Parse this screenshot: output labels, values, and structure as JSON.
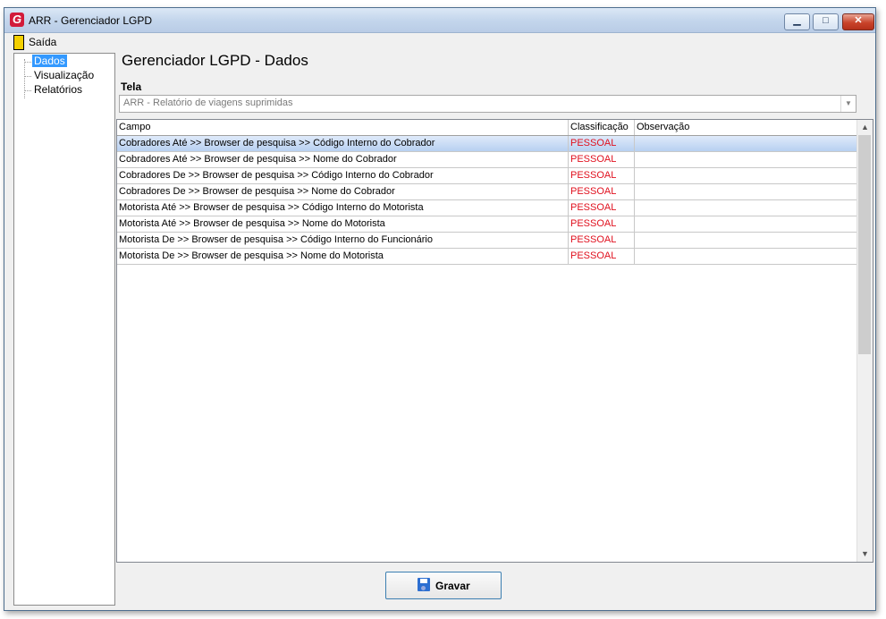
{
  "window": {
    "title": "ARR - Gerenciador LGPD",
    "minimize": "▁",
    "maximize": "□",
    "close": "✕"
  },
  "menu": {
    "exit_label": "Saída"
  },
  "sidebar": {
    "items": [
      {
        "label": "Dados",
        "selected": true
      },
      {
        "label": "Visualização",
        "selected": false
      },
      {
        "label": "Relatórios",
        "selected": false
      }
    ]
  },
  "main": {
    "title": "Gerenciador LGPD - Dados",
    "tela_label": "Tela",
    "tela_value": "ARR - Relatório de viagens suprimidas",
    "combo_arrow": "▼",
    "columns": [
      "Campo",
      "Classificação",
      "Observação"
    ],
    "rows": [
      {
        "campo": "Cobradores Até >> Browser de pesquisa >> Código Interno do Cobrador",
        "classificacao": "PESSOAL",
        "observacao": ""
      },
      {
        "campo": "Cobradores Até >> Browser de pesquisa >> Nome do Cobrador",
        "classificacao": "PESSOAL",
        "observacao": ""
      },
      {
        "campo": "Cobradores De >> Browser de pesquisa >> Código Interno do Cobrador",
        "classificacao": "PESSOAL",
        "observacao": ""
      },
      {
        "campo": "Cobradores De >> Browser de pesquisa >> Nome do Cobrador",
        "classificacao": "PESSOAL",
        "observacao": ""
      },
      {
        "campo": "Motorista Até >> Browser de pesquisa >> Código Interno do Motorista",
        "classificacao": "PESSOAL",
        "observacao": ""
      },
      {
        "campo": "Motorista Até >> Browser de pesquisa >> Nome do Motorista",
        "classificacao": "PESSOAL",
        "observacao": ""
      },
      {
        "campo": "Motorista De >> Browser de pesquisa >> Código Interno do Funcionário",
        "classificacao": "PESSOAL",
        "observacao": ""
      },
      {
        "campo": "Motorista De >> Browser de pesquisa >> Nome do Motorista",
        "classificacao": "PESSOAL",
        "observacao": ""
      }
    ],
    "selected_row": 0,
    "scroll_up": "▲",
    "scroll_down": "▼"
  },
  "footer": {
    "save_label": "Gravar"
  },
  "colors": {
    "accent": "#3399ff",
    "classification": "#e0101e",
    "selected_row": "#b7d0f1"
  }
}
